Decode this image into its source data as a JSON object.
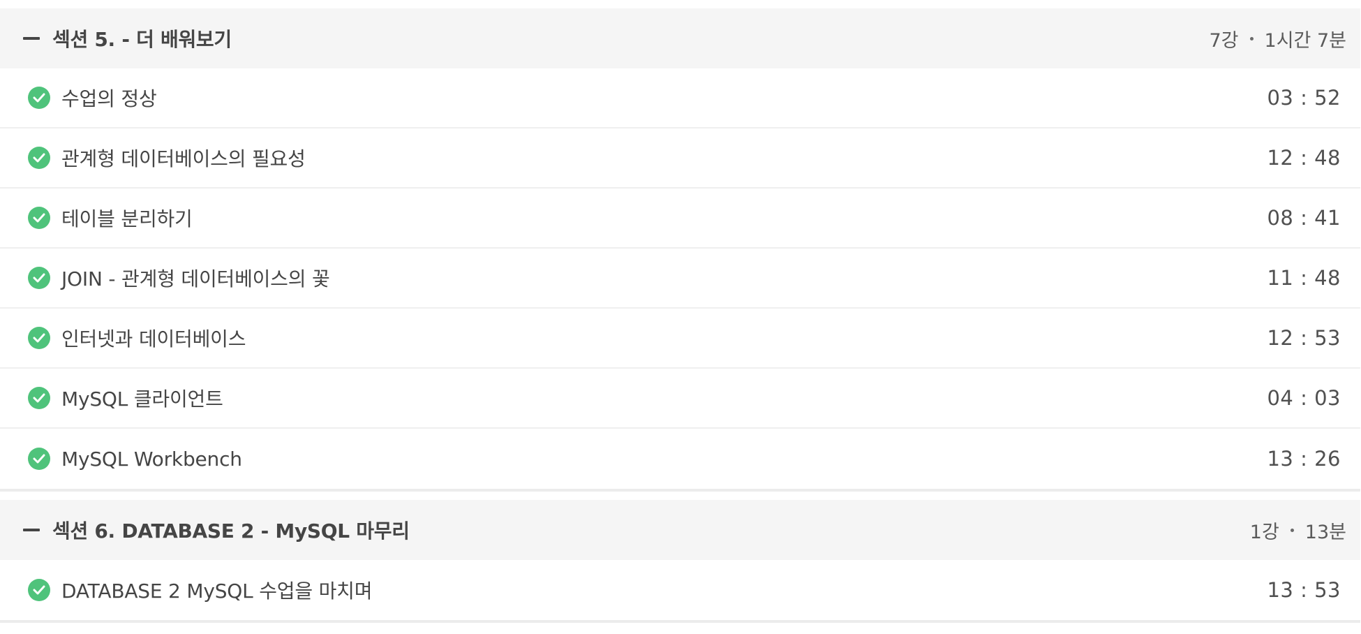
{
  "sections": [
    {
      "title": "섹션 5. - 더 배워보기",
      "count": "7강",
      "duration": "1시간 7분",
      "lessons": [
        {
          "title": "수업의 정상",
          "time": "03 : 52"
        },
        {
          "title": "관계형 데이터베이스의 필요성",
          "time": "12 : 48"
        },
        {
          "title": "테이블 분리하기",
          "time": "08 : 41"
        },
        {
          "title": "JOIN - 관계형 데이터베이스의 꽃",
          "time": "11 : 48"
        },
        {
          "title": "인터넷과 데이터베이스",
          "time": "12 : 53"
        },
        {
          "title": "MySQL 클라이언트",
          "time": "04 : 03"
        },
        {
          "title": "MySQL Workbench",
          "time": "13 : 26"
        }
      ]
    },
    {
      "title": "섹션 6. DATABASE 2 - MySQL 마무리",
      "count": "1강",
      "duration": "13분",
      "lessons": [
        {
          "title": "DATABASE 2 MySQL 수업을 마치며",
          "time": "13 : 53"
        }
      ]
    }
  ],
  "icons": {
    "collapse": "minus-icon",
    "completed": "check-circle-icon"
  },
  "colors": {
    "completed": "#4fc37b",
    "header_bg": "#f5f5f5",
    "text": "#454545"
  }
}
